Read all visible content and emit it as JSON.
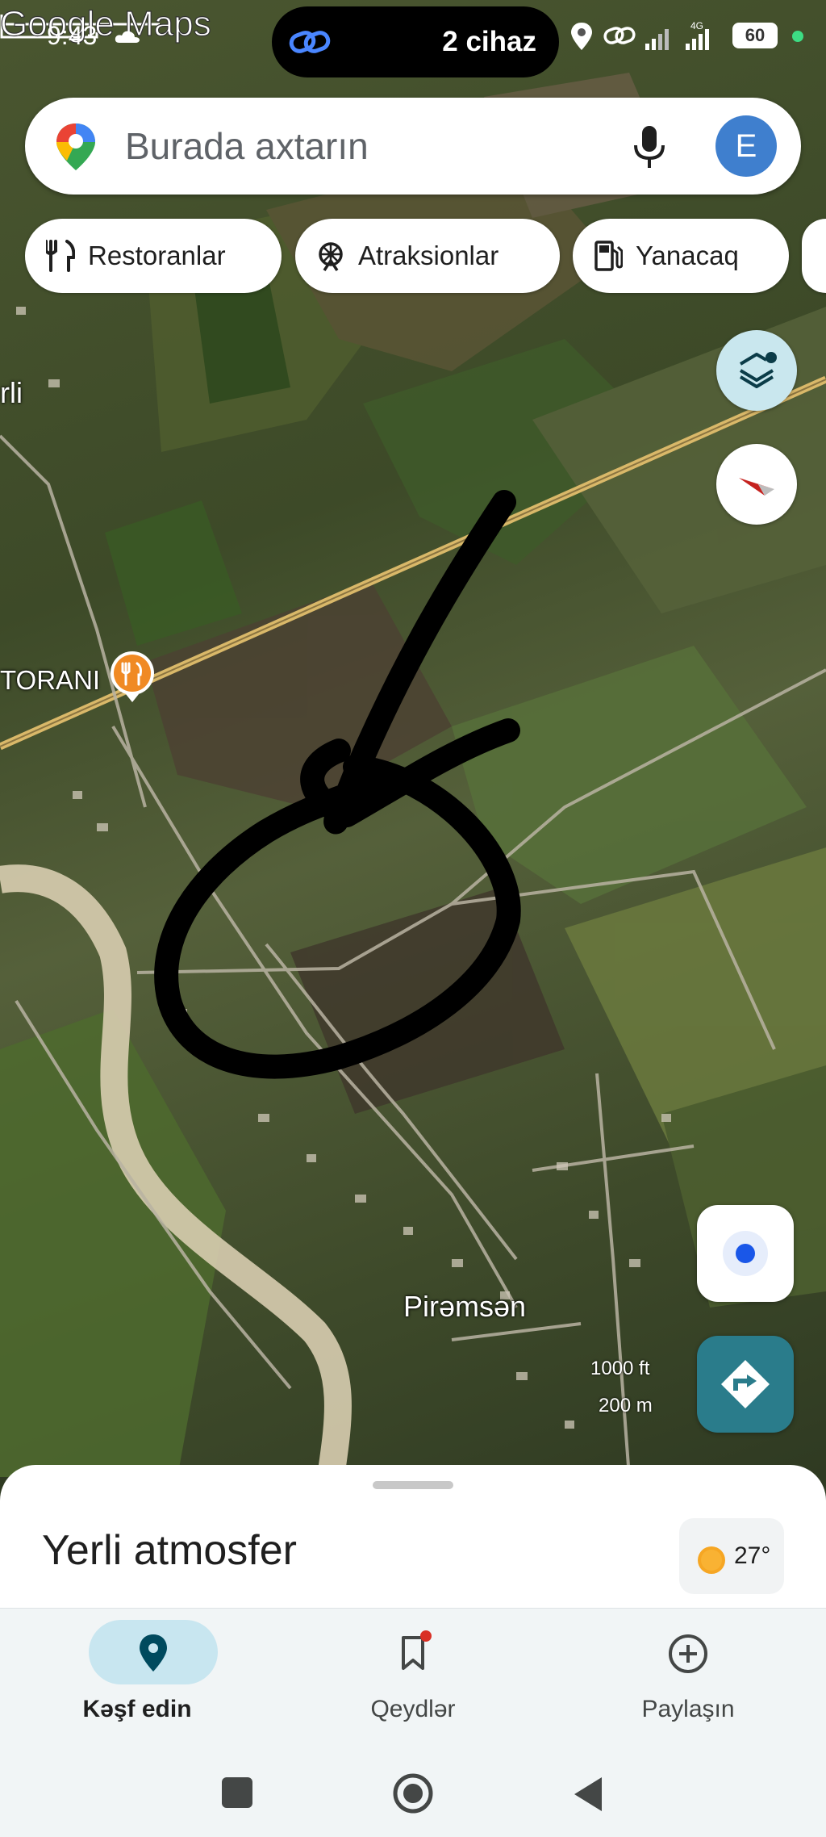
{
  "status_bar": {
    "time": "9:43",
    "pill_text": "2 cihaz",
    "network": "4G",
    "battery": "60",
    "icons": [
      "cloud-icon",
      "link-icon",
      "location-icon",
      "signal-icon",
      "battery-icon"
    ]
  },
  "search": {
    "placeholder": "Burada axtarın",
    "avatar_letter": "E"
  },
  "chips": [
    {
      "label": "Restoranlar",
      "icon": "restaurant-icon"
    },
    {
      "label": "Atraksionlar",
      "icon": "attraction-icon"
    },
    {
      "label": "Yanacaq",
      "icon": "fuel-icon"
    }
  ],
  "map": {
    "labels": {
      "restaurant": "TORANI",
      "edge": "rli",
      "village": "Pirəmsən"
    },
    "scale": {
      "feet": "1000 ft",
      "meters": "200 m"
    },
    "watermark": "Google Maps"
  },
  "sheet": {
    "title": "Yerli atmosfer",
    "temperature": "27°"
  },
  "bottom_nav": [
    {
      "label": "Kəşf edin",
      "icon": "explore-pin-icon",
      "active": true
    },
    {
      "label": "Qeydlər",
      "icon": "bookmark-icon",
      "badge": true
    },
    {
      "label": "Paylaşın",
      "icon": "add-circle-icon"
    }
  ],
  "colors": {
    "accent": "#3f7fce",
    "nav_active_pill": "#c8e6f0",
    "directions": "#2a7c8b",
    "road": "#d9b869"
  }
}
